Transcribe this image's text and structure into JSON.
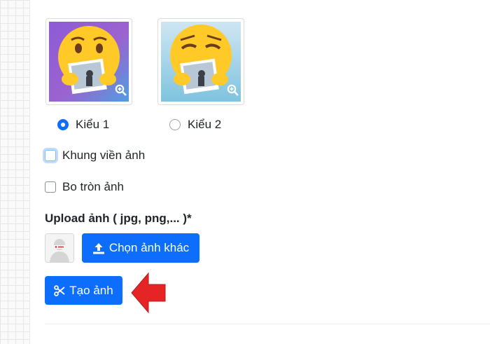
{
  "styles": {
    "options": [
      {
        "label": "Kiểu 1",
        "selected": true
      },
      {
        "label": "Kiểu 2",
        "selected": false
      }
    ]
  },
  "options": {
    "frame_label": "Khung viền ảnh",
    "frame_checked": false,
    "round_label": "Bo tròn ảnh",
    "round_checked": false
  },
  "upload": {
    "label": "Upload ảnh ( jpg, png,... )*",
    "choose_button": "Chọn ảnh khác"
  },
  "actions": {
    "create_button": "Tạo ảnh"
  },
  "icons": {
    "zoom": "zoom-in-icon",
    "upload": "upload-icon",
    "scissors": "scissors-icon",
    "pointer": "red-arrow-icon"
  },
  "colors": {
    "primary": "#0d6efd",
    "arrow": "#e52426",
    "card1_bg": "#8e5bd6",
    "card2_bg": "#7fc3df",
    "emoji": "#ffc928"
  }
}
